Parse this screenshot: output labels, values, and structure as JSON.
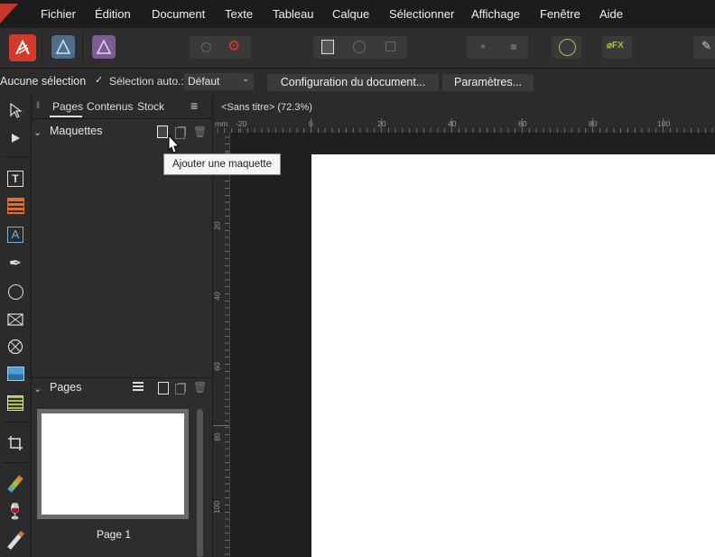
{
  "menu": {
    "items": [
      "Fichier",
      "Édition",
      "Document",
      "Texte",
      "Tableau",
      "Calque",
      "Sélectionner",
      "Affichage",
      "Fenêtre",
      "Aide"
    ]
  },
  "context": {
    "selection_label": "Aucune sélection",
    "auto_select_label": "Sélection auto.:",
    "auto_select_value": "Défaut",
    "doc_setup_button": "Configuration du document...",
    "settings_button": "Paramètres..."
  },
  "panel": {
    "tabs": [
      "Pages",
      "Contenus",
      "Stock"
    ],
    "masters_title": "Maquettes",
    "pages_title": "Pages",
    "page_thumb_label": "Page 1"
  },
  "tooltip": "Ajouter une maquette",
  "document": {
    "tab_title": "<Sans titre> (72.3%)",
    "ruler_unit": "mm",
    "ruler_top_labels": [
      "-20",
      "0",
      "20",
      "40",
      "60",
      "80",
      "100"
    ],
    "ruler_left_labels": [
      "20",
      "40",
      "60",
      "80",
      "100"
    ]
  },
  "colors": {
    "accent": "#c8372b",
    "app_bg": "#2b2b2b",
    "canvas_bg": "#202020"
  }
}
